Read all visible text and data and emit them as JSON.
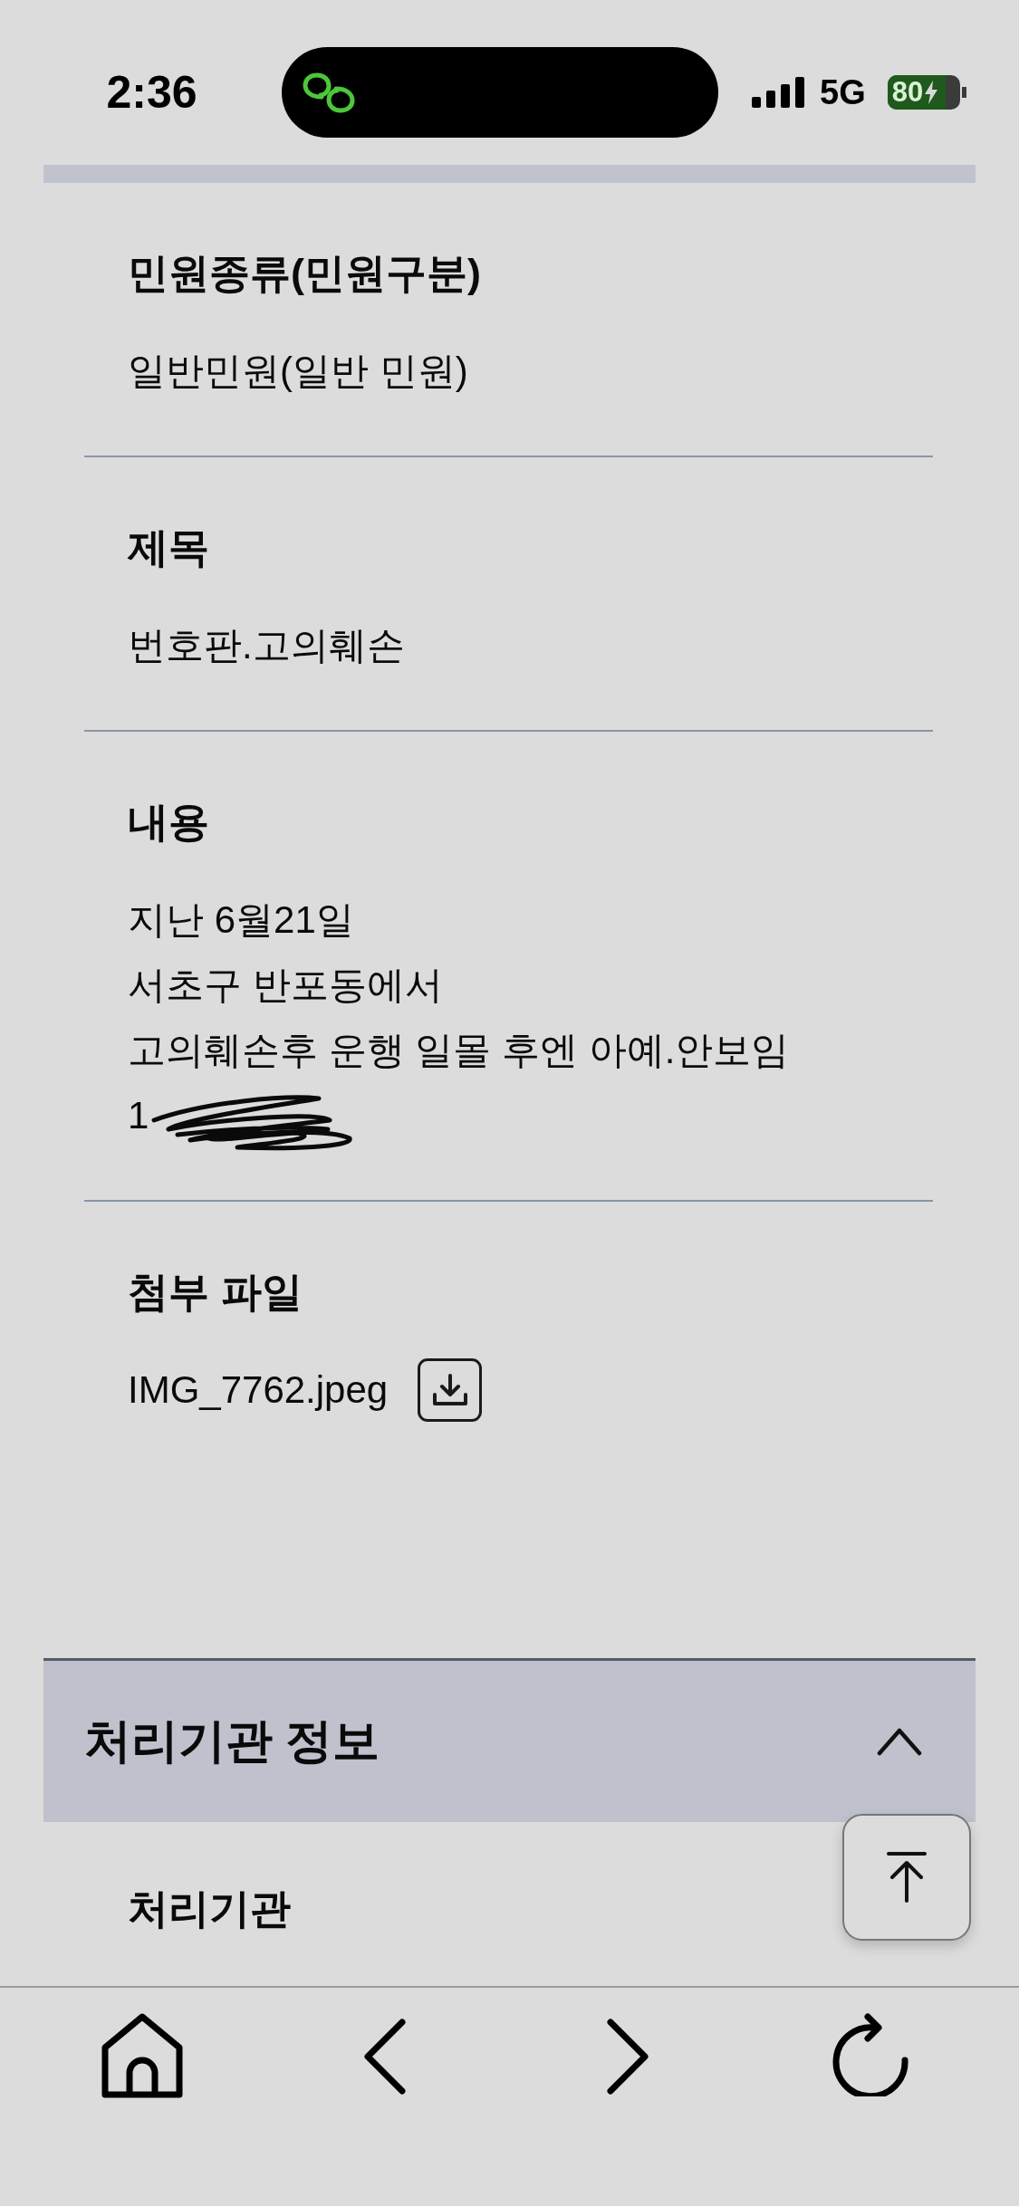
{
  "status_bar": {
    "time": "2:36",
    "network": "5G",
    "battery": "80"
  },
  "sections": [
    {
      "kind": "text",
      "label": "민원종류(민원구분)",
      "lines": [
        {
          "text": "일반민원(일반 민원)",
          "redacted": false
        }
      ]
    },
    {
      "kind": "text",
      "label": "제목",
      "lines": [
        {
          "text": "번호판.고의훼손",
          "redacted": false
        }
      ]
    },
    {
      "kind": "text",
      "label": "내용",
      "lines": [
        {
          "text": "지난 6월21일",
          "redacted": false
        },
        {
          "text": "서초구 반포동에서",
          "redacted": false
        },
        {
          "text": "고의훼손후 운행 일몰 후엔 아예.안보임",
          "redacted": false
        },
        {
          "text": "1",
          "redacted": true
        }
      ]
    },
    {
      "kind": "attachment",
      "label": "첨부 파일",
      "file": "IMG_7762.jpeg"
    }
  ],
  "panel": {
    "title": "처리기관 정보",
    "expanded": true,
    "fields": [
      {
        "label": "처리기관"
      }
    ]
  }
}
